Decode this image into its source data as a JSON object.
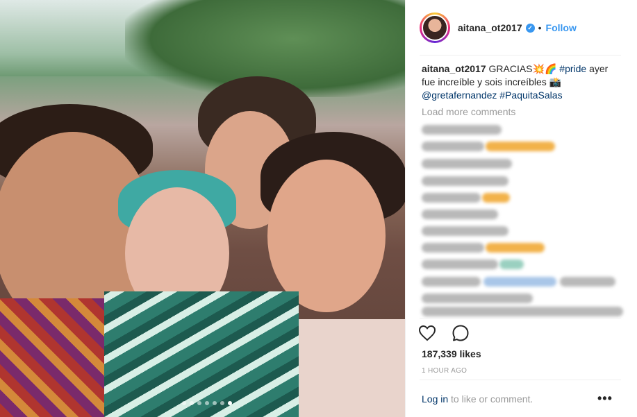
{
  "post": {
    "username": "aitana_ot2017",
    "verified_symbol": "✓",
    "separator": "•",
    "follow_label": "Follow",
    "caption": {
      "username": "aitana_ot2017",
      "text_1": "GRACIAS",
      "emoji_1": "💥🌈",
      "hashtag_1": "#pride",
      "text_2": "ayer fue increíble y sois increíbles",
      "emoji_2": "📸",
      "mention": "@gretafernandez",
      "hashtag_2": "#PaquitaSalas"
    },
    "load_more_label": "Load more comments",
    "likes": "187,339 likes",
    "time_ago": "1 HOUR AGO",
    "login_link": "Log in",
    "login_rest": "to like or comment.",
    "more_options": "•••",
    "carousel_count": 7,
    "carousel_active_index": 6
  },
  "icons": {
    "like": "heart-icon",
    "comment": "comment-bubble-icon",
    "verified": "verified-badge-icon"
  },
  "colors": {
    "link_blue": "#3897f0",
    "caption_link": "#003569",
    "muted": "#999999"
  }
}
